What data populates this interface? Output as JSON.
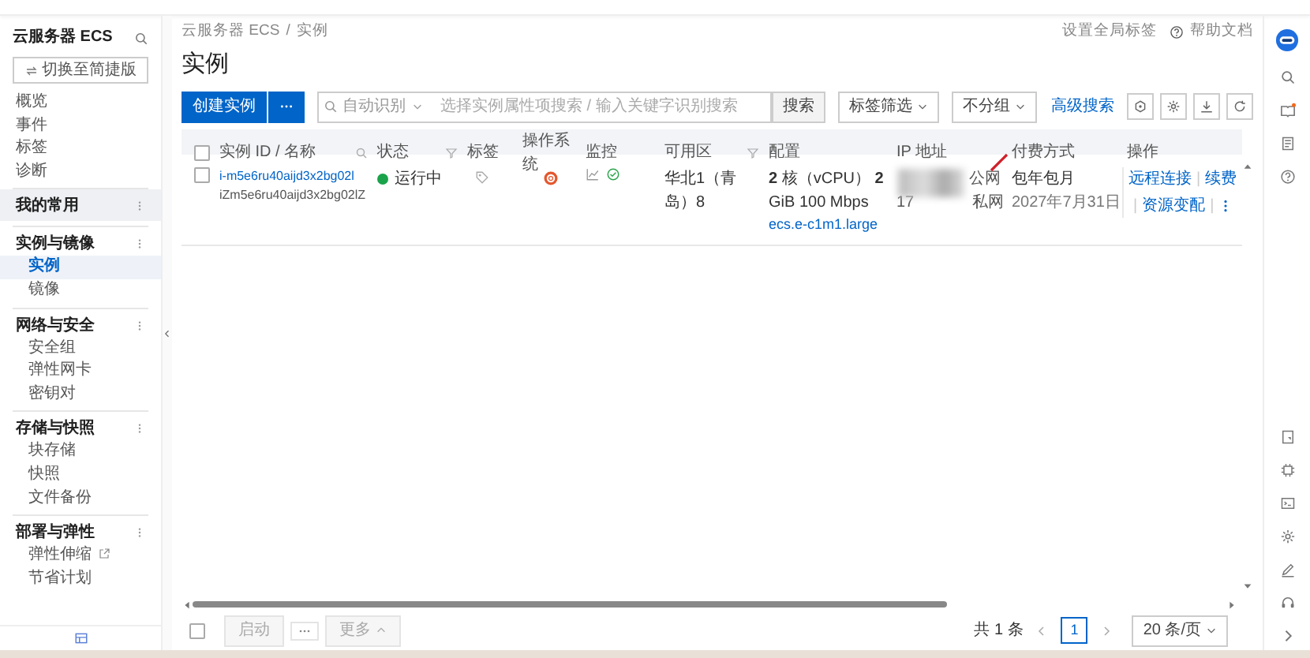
{
  "sidebar": {
    "title": "云服务器 ECS",
    "switch_button": "切换至简捷版",
    "items": [
      {
        "label": "概览",
        "selected": false
      },
      {
        "label": "事件",
        "selected": false
      },
      {
        "label": "标签",
        "selected": false
      },
      {
        "label": "诊断",
        "selected": false
      }
    ],
    "groups": [
      {
        "label": "我的常用",
        "highlighted": true
      },
      {
        "label": "实例与镜像",
        "highlighted": false,
        "children": [
          {
            "label": "实例",
            "selected": true
          },
          {
            "label": "镜像",
            "selected": false
          }
        ]
      },
      {
        "label": "网络与安全",
        "highlighted": false,
        "children": [
          {
            "label": "安全组",
            "selected": false
          },
          {
            "label": "弹性网卡",
            "selected": false
          },
          {
            "label": "密钥对",
            "selected": false
          }
        ]
      },
      {
        "label": "存储与快照",
        "highlighted": false,
        "children": [
          {
            "label": "块存储",
            "selected": false
          },
          {
            "label": "快照",
            "selected": false
          },
          {
            "label": "文件备份",
            "selected": false
          }
        ]
      },
      {
        "label": "部署与弹性",
        "highlighted": false,
        "children": [
          {
            "label": "弹性伸缩",
            "selected": false,
            "external": true
          },
          {
            "label": "节省计划",
            "selected": false
          }
        ]
      }
    ]
  },
  "header": {
    "breadcrumb": [
      {
        "label": "云服务器 ECS"
      },
      {
        "label": "实例"
      }
    ],
    "breadcrumb_separator": "/",
    "global_tag_link": "设置全局标签",
    "help_link": "帮助文档"
  },
  "title": "实例",
  "toolbar": {
    "create_button": "创建实例",
    "search": {
      "mode": "自动识别",
      "placeholder": "选择实例属性项搜索 / 输入关键字识别搜索",
      "button": "搜索"
    },
    "tag_filter": "标签筛选",
    "grouping": "不分组",
    "advanced_search": "高级搜索"
  },
  "table": {
    "header_checked": false,
    "columns": [
      {
        "label": "实例 ID / 名称",
        "searchable": true
      },
      {
        "label": "状态",
        "filterable": true
      },
      {
        "label": "标签"
      },
      {
        "label": "操作系统"
      },
      {
        "label": "监控"
      },
      {
        "label": "可用区",
        "filterable": true
      },
      {
        "label": "配置"
      },
      {
        "label": "IP 地址"
      },
      {
        "label": "付费方式"
      },
      {
        "label": "操作"
      }
    ],
    "rows": [
      {
        "checked": false,
        "id": "i-m5e6ru40aijd3x2bg02l",
        "name": "iZm5e6ru40aijd3x2bg02lZ",
        "status": {
          "label": "运行中",
          "color": "#1aa34a"
        },
        "zone": "华北1（青岛）8",
        "config": "**2** 核（vCPU） **2** GiB 100 Mbps",
        "instance_type": "ecs.e-c1m1.large",
        "ip": {
          "public": "公网",
          "private_prefix": "17",
          "private": "私网"
        },
        "billing": "包年包月",
        "expiry": "2027年7月31日",
        "actions": [
          {
            "label": "远程连接",
            "separator": "|"
          },
          {
            "label": "续费",
            "separator": "|"
          },
          {
            "label": "资源变配",
            "separator": "|"
          }
        ]
      }
    ]
  },
  "footer": {
    "checked": false,
    "buttons": [
      {
        "label": "启动",
        "disabled": true
      },
      {
        "label": "更多",
        "disabled": true
      }
    ],
    "total": "共 1 条",
    "pages": [
      {
        "label": "1",
        "selected": true
      }
    ],
    "page_size": "20 条/页"
  }
}
